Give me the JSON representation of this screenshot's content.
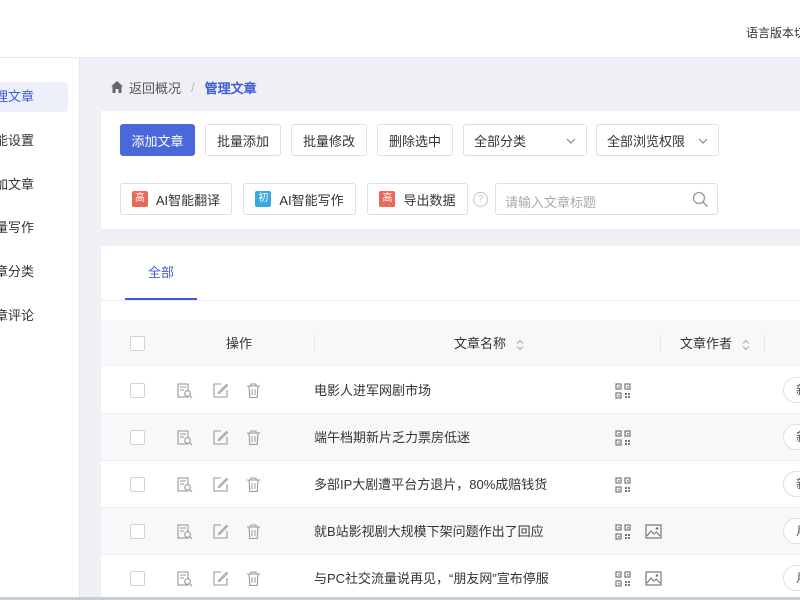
{
  "header": {
    "language_label": "语言版本切"
  },
  "sidebar": {
    "items": [
      {
        "label": "管理文章",
        "active": true
      },
      {
        "label": "功能设置",
        "active": false
      },
      {
        "label": "添加文章",
        "active": false
      },
      {
        "label": "AI批量写作",
        "active": false
      },
      {
        "label": "文章分类",
        "active": false
      },
      {
        "label": "文章评论",
        "active": false
      }
    ]
  },
  "breadcrumb": {
    "back": "返回概况",
    "separator": "/",
    "current": "管理文章"
  },
  "toolbar": {
    "add_article": "添加文章",
    "batch_add": "批量添加",
    "batch_edit": "批量修改",
    "delete_selected": "删除选中",
    "category_select": "全部分类",
    "permission_select": "全部浏览权限",
    "ai_translate_tag": "高",
    "ai_translate": "AI智能翻译",
    "ai_write_tag": "初",
    "ai_write": "AI智能写作",
    "export_tag": "高",
    "export": "导出数据",
    "help": "?",
    "search_placeholder": "请输入文章标题"
  },
  "tabs": [
    {
      "label": "全部"
    }
  ],
  "table": {
    "columns": {
      "actions": "操作",
      "title": "文章名称",
      "author": "文章作者"
    },
    "rows": [
      {
        "title": "电影人进军网剧市场",
        "has_image": false,
        "pill": "新"
      },
      {
        "title": "端午档期新片乏力票房低迷",
        "has_image": false,
        "pill": "新"
      },
      {
        "title": "多部IP大剧遭平台方退片，80%成赔钱货",
        "has_image": false,
        "pill": "新"
      },
      {
        "title": "就B站影视剧大规模下架问题作出了回应",
        "has_image": true,
        "pill": "月"
      },
      {
        "title": "与PC社交流量说再见，“朋友网”宣布停服",
        "has_image": true,
        "pill": "月"
      }
    ]
  },
  "colors": {
    "primary": "#4a68d9",
    "tag_red": "#e8685a",
    "tag_blue": "#3aa8e0"
  }
}
